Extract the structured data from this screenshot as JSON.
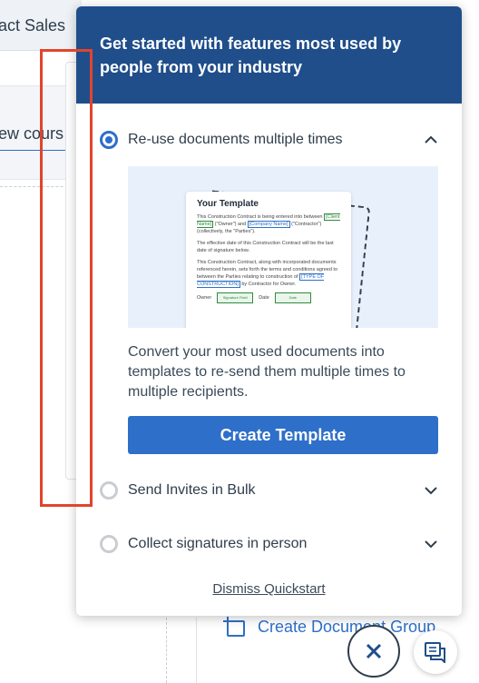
{
  "background": {
    "tab_label": "act Sales",
    "input_text": "ew cours",
    "group_button_label": "Create Document Group"
  },
  "quickstart": {
    "header": "Get started with features most used by people from your industry",
    "items": [
      {
        "label": "Re-use documents multiple times",
        "expanded": true,
        "active": true
      },
      {
        "label": "Send Invites in Bulk",
        "expanded": false,
        "active": false
      },
      {
        "label": "Collect signatures in person",
        "expanded": false,
        "active": false
      }
    ],
    "preview": {
      "title": "Your Template",
      "para1_a": "This Construction Contract is being entered into between",
      "client_field": "[Client Name]",
      "para1_b": "(\"Owner\") and",
      "company_field": "[Company Name]",
      "para1_c": "(\"Contractor\") (collectively, the \"Parties\").",
      "para2": "The effective date of this Construction Contract will be the last date of signature below.",
      "para3_a": "This Construction Contract, along with incorporated documents referenced herein, sets forth the terms and conditions agreed to between the Parties relating to construction of",
      "type_field": "[TYPE OF CONSTRUCTION]",
      "para3_b": "by Contractor for Owner.",
      "owner_label": "Owner",
      "signature_field": "Signature Field",
      "date_label": "Date",
      "date_field": "Date"
    },
    "description": "Convert your most used documents into templates to re-send them multiple times to multiple recipients.",
    "cta_label": "Create Template",
    "dismiss_label": "Dismiss Quickstart"
  },
  "colors": {
    "header_bg": "#1f4e8a",
    "primary": "#2e6fc9",
    "highlight": "#e2442c"
  },
  "icons": {
    "close": "close-icon",
    "chat": "chat-icon",
    "add_group": "add-document-group-icon"
  }
}
